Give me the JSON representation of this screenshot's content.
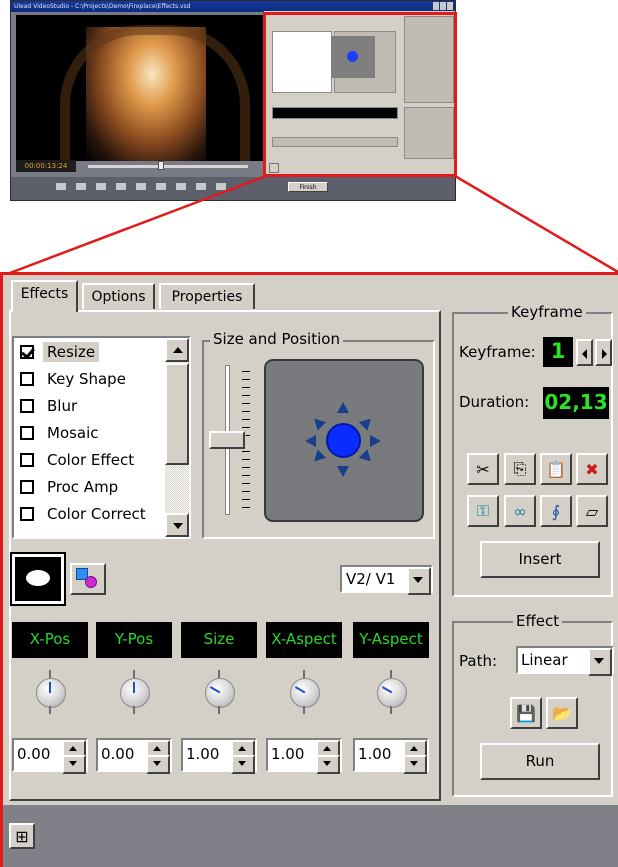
{
  "window": {
    "title": "Ulead VideoStudio - C:\\Projects\\Demo\\Fireplace\\Effects.vsd",
    "timecode": "00:00:13:24",
    "done_label": "Finish"
  },
  "tabs": [
    "Effects",
    "Options",
    "Properties"
  ],
  "effects_list": [
    {
      "label": "Resize",
      "checked": true,
      "selected": true
    },
    {
      "label": "Key Shape",
      "checked": false
    },
    {
      "label": "Blur",
      "checked": false
    },
    {
      "label": "Mosaic",
      "checked": false
    },
    {
      "label": "Color Effect",
      "checked": false
    },
    {
      "label": "Proc Amp",
      "checked": false
    },
    {
      "label": "Color Correct",
      "checked": false
    }
  ],
  "size_position": {
    "title": "Size and Position",
    "center_color": "#0a2cff"
  },
  "track_select": {
    "value": "V2/ V1"
  },
  "parameters": [
    {
      "label": "X-Pos",
      "value": "0.00"
    },
    {
      "label": "Y-Pos",
      "value": "0.00"
    },
    {
      "label": "Size",
      "value": "1.00"
    },
    {
      "label": "X-Aspect",
      "value": "1.00"
    },
    {
      "label": "Y-Aspect",
      "value": "1.00"
    }
  ],
  "keyframe": {
    "title": "Keyframe",
    "keyframe_label": "Keyframe:",
    "keyframe_value": "1",
    "duration_label": "Duration:",
    "duration_value": "02,13",
    "tools_row1": [
      "cut-icon",
      "copy-icon",
      "paste-icon",
      "delete-icon"
    ],
    "tools_row2": [
      "key-add-icon",
      "link-icon",
      "curve-icon",
      "eraser-icon"
    ],
    "insert_label": "Insert"
  },
  "effect": {
    "title": "Effect",
    "path_label": "Path:",
    "path_value": "Linear",
    "run_label": "Run"
  },
  "colors": {
    "highlight": "#e21a1a",
    "lcd_text": "#26d926",
    "panel_bg": "#d4d0c8"
  }
}
